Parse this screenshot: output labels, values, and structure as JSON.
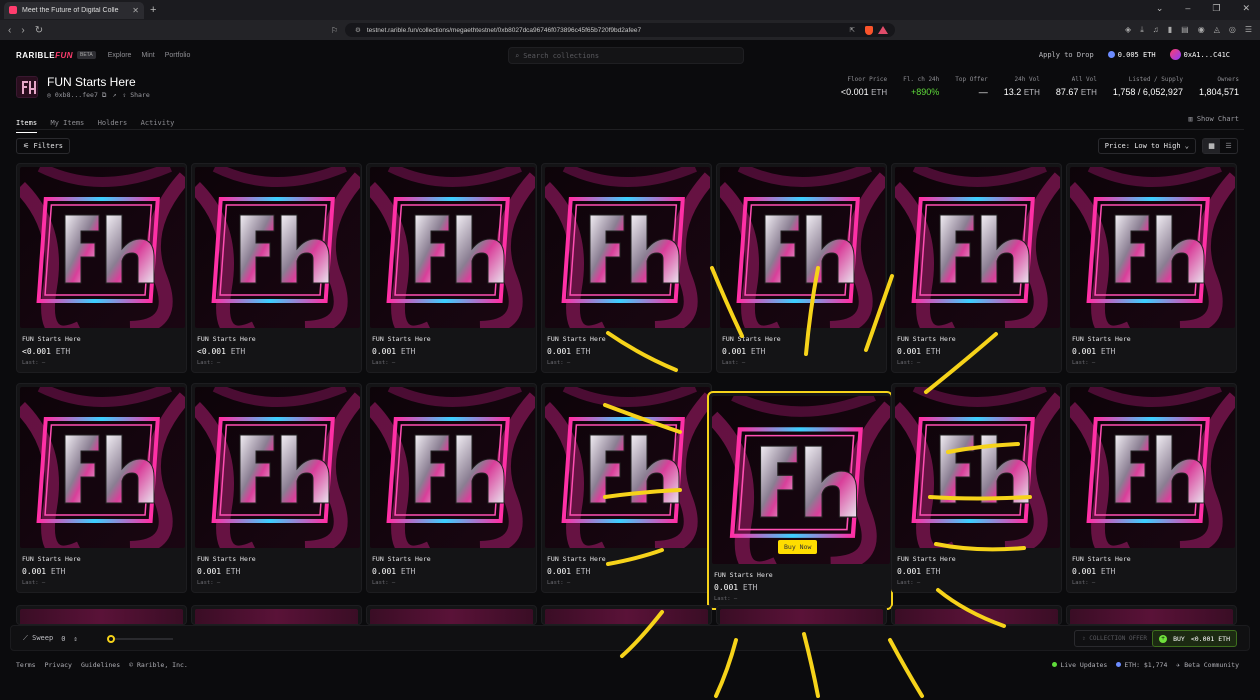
{
  "browser": {
    "tab_title": "Meet the Future of Digital Colle",
    "url": "testnet.rarible.fun/collections/megaethtestnet/0xb8027dca96746f073896c45f65b720f9bd2afee7"
  },
  "header": {
    "logo_main": "RARIBLE",
    "logo_accent": "FUN",
    "beta": "BETA",
    "nav": [
      "Explore",
      "Mint",
      "Portfolio"
    ],
    "search_placeholder": "Search collections",
    "apply": "Apply to Drop",
    "balance": "0.005 ETH",
    "address": "0xA1...C41C"
  },
  "collection": {
    "name": "FUN Starts Here",
    "contract": "0xb8...fee7",
    "share": "Share",
    "stats": [
      {
        "label": "Floor Price",
        "value": "<0.001",
        "unit": "ETH"
      },
      {
        "label": "Fl. ch 24h",
        "value": "+890%",
        "unit": ""
      },
      {
        "label": "Top Offer",
        "value": "—",
        "unit": ""
      },
      {
        "label": "24h Vol",
        "value": "13.2",
        "unit": "ETH"
      },
      {
        "label": "All Vol",
        "value": "87.67",
        "unit": "ETH"
      },
      {
        "label": "Listed / Supply",
        "value": "1,758 / 6,052,927",
        "unit": ""
      },
      {
        "label": "Owners",
        "value": "1,804,571",
        "unit": ""
      }
    ]
  },
  "tabs": [
    "Items",
    "My Items",
    "Holders",
    "Activity"
  ],
  "show_chart": "Show Chart",
  "filters": "Filters",
  "sort": "Price: Low to High",
  "items": [
    {
      "name": "FUN Starts Here",
      "price": "<0.001",
      "unit": "ETH",
      "last": "Last: –"
    },
    {
      "name": "FUN Starts Here",
      "price": "<0.001",
      "unit": "ETH",
      "last": "Last: –"
    },
    {
      "name": "FUN Starts Here",
      "price": "0.001",
      "unit": "ETH",
      "last": "Last: –"
    },
    {
      "name": "FUN Starts Here",
      "price": "0.001",
      "unit": "ETH",
      "last": "Last: –"
    },
    {
      "name": "FUN Starts Here",
      "price": "0.001",
      "unit": "ETH",
      "last": "Last: –"
    },
    {
      "name": "FUN Starts Here",
      "price": "0.001",
      "unit": "ETH",
      "last": "Last: –"
    },
    {
      "name": "FUN Starts Here",
      "price": "0.001",
      "unit": "ETH",
      "last": "Last: –"
    },
    {
      "name": "FUN Starts Here",
      "price": "0.001",
      "unit": "ETH",
      "last": "Last: –"
    },
    {
      "name": "FUN Starts Here",
      "price": "0.001",
      "unit": "ETH",
      "last": "Last: –"
    },
    {
      "name": "FUN Starts Here",
      "price": "0.001",
      "unit": "ETH",
      "last": "Last: –"
    },
    {
      "name": "FUN Starts Here",
      "price": "0.001",
      "unit": "ETH",
      "last": "Last: –"
    },
    {
      "name": "FUN Starts Here",
      "price": "0.001",
      "unit": "ETH",
      "last": "Last: –"
    },
    {
      "name": "FUN Starts Here",
      "price": "0.001",
      "unit": "ETH",
      "last": "Last: –"
    },
    {
      "name": "FUN Starts Here",
      "price": "0.001",
      "unit": "ETH",
      "last": "Last: –"
    }
  ],
  "buy_now": "Buy Now",
  "sweep": {
    "label": "Sweep",
    "count": "0",
    "collection_offer": "COLLECTION OFFER",
    "buy": "BUY",
    "buy_price": "<0.001 ETH"
  },
  "footer": {
    "links": [
      "Terms",
      "Privacy",
      "Guidelines",
      "© Rarible, Inc."
    ],
    "live": "Live Updates",
    "eth": "ETH: $1,774",
    "beta_comm": "Beta Community"
  },
  "colors": {
    "accent": "#ff3d6e",
    "highlight": "#f6d31a",
    "green": "#5fdc3a"
  }
}
